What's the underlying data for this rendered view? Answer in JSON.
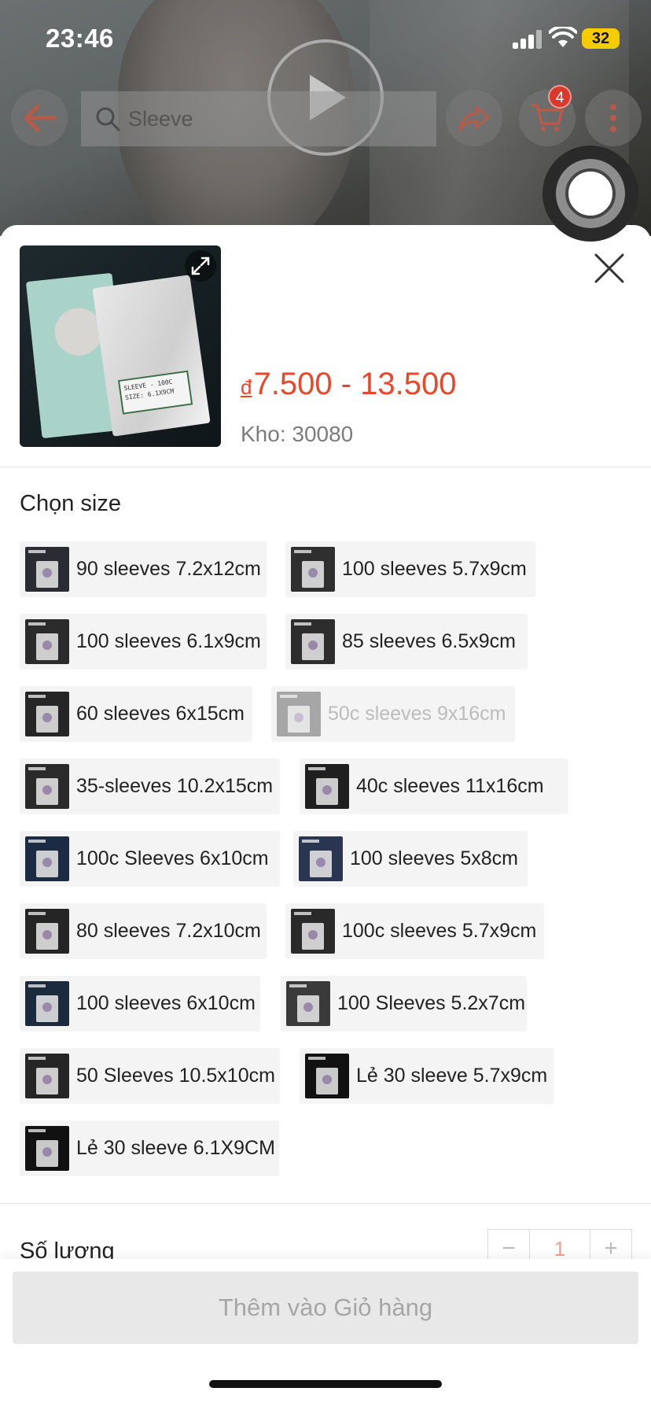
{
  "status_bar": {
    "time": "23:46",
    "battery": "32"
  },
  "nav": {
    "search_placeholder": "Sleeve",
    "cart_count": "4"
  },
  "product": {
    "currency": "đ",
    "price_range": "7.500 - 13.500",
    "stock_label": "Kho: 30080",
    "thumb_label_lines": [
      "SLEEVE - 100C",
      "SIZE: 6.1X9CM"
    ]
  },
  "variants": {
    "title": "Chọn size",
    "options": [
      {
        "label": "90 sleeves 7.2x12cm",
        "thumb": "#2b2b33",
        "disabled": false
      },
      {
        "label": "100 sleeves 5.7x9cm",
        "thumb": "#2f2f2f",
        "disabled": false
      },
      {
        "label": "100 sleeves 6.1x9cm",
        "thumb": "#2b2b2b",
        "disabled": false
      },
      {
        "label": "85 sleeves 6.5x9cm",
        "thumb": "#2d2d2d",
        "disabled": false
      },
      {
        "label": "60 sleeves 6x15cm",
        "thumb": "#262626",
        "disabled": false
      },
      {
        "label": "50c sleeves 9x16cm",
        "thumb": "#5a5a5a",
        "disabled": true
      },
      {
        "label": "35-sleeves 10.2x15cm",
        "thumb": "#2a2a2a",
        "disabled": false
      },
      {
        "label": "40c sleeves 11x16cm",
        "thumb": "#1f1f1f",
        "disabled": false
      },
      {
        "label": "100c Sleeves 6x10cm",
        "thumb": "#1b2b44",
        "disabled": false
      },
      {
        "label": "100 sleeves 5x8cm",
        "thumb": "#2a3552",
        "disabled": false
      },
      {
        "label": "80 sleeves 7.2x10cm",
        "thumb": "#252525",
        "disabled": false
      },
      {
        "label": "100c sleeves 5.7x9cm",
        "thumb": "#2a2a2a",
        "disabled": false
      },
      {
        "label": "100 sleeves 6x10cm",
        "thumb": "#1c2a3d",
        "disabled": false
      },
      {
        "label": "100 Sleeves 5.2x7cm",
        "thumb": "#3a3a3a",
        "disabled": false
      },
      {
        "label": "50 Sleeves 10.5x10cm",
        "thumb": "#262626",
        "disabled": false
      },
      {
        "label": "Lẻ 30 sleeve 5.7x9cm",
        "thumb": "#111111",
        "disabled": false
      },
      {
        "label": "Lẻ 30 sleeve 6.1X9CM",
        "thumb": "#111111",
        "disabled": false
      }
    ]
  },
  "quantity": {
    "label": "Số lượng",
    "value": "1",
    "minus": "−",
    "plus": "+"
  },
  "footer": {
    "add_to_cart": "Thêm vào Giỏ hàng"
  },
  "colors": {
    "accent": "#e8472a",
    "cart_badge": "#d9382a",
    "disabled_button": "#e8e8e8"
  }
}
